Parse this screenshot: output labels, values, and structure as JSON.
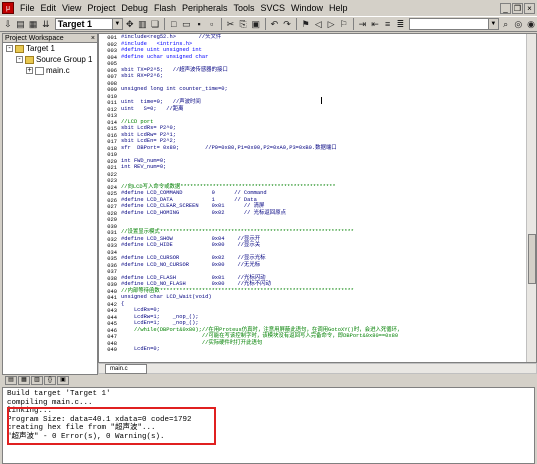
{
  "menu": {
    "items": [
      "File",
      "Edit",
      "View",
      "Project",
      "Debug",
      "Flash",
      "Peripherals",
      "Tools",
      "SVCS",
      "Window",
      "Help"
    ],
    "app_icon": "uvision-icon"
  },
  "toolbar": {
    "target": "Target 1"
  },
  "workspace": {
    "title": "Project Workspace",
    "tree": [
      {
        "label": "Target 1",
        "level": 0,
        "toggle": "-"
      },
      {
        "label": "Source Group 1",
        "level": 1,
        "toggle": "-"
      },
      {
        "label": "main.c",
        "level": 2,
        "toggle": "+"
      }
    ]
  },
  "editor": {
    "tab": "main.c",
    "lines": [
      {
        "n": "001",
        "t": "#include<reg52.h>       //头文件"
      },
      {
        "n": "002",
        "t": "#include   <intrins.h>"
      },
      {
        "n": "003",
        "t": "#define uint unsigned int"
      },
      {
        "n": "004",
        "t": "#define uchar unsigned char"
      },
      {
        "n": "005",
        "t": ""
      },
      {
        "n": "006",
        "t": "sbit TX=P2^5;   //超声波传感器的接口"
      },
      {
        "n": "007",
        "t": "sbit RX=P2^6;"
      },
      {
        "n": "008",
        "t": ""
      },
      {
        "n": "009",
        "t": "unsigned long int counter_time=0;"
      },
      {
        "n": "010",
        "t": ""
      },
      {
        "n": "011",
        "t": "uint  time=0;   //声波时间"
      },
      {
        "n": "012",
        "t": "uint   S=0;   //距离"
      },
      {
        "n": "013",
        "t": ""
      },
      {
        "n": "014",
        "t": "//LCD port"
      },
      {
        "n": "015",
        "t": "sbit LcdRs= P2^0;"
      },
      {
        "n": "016",
        "t": "sbit LcdRw= P2^1;"
      },
      {
        "n": "017",
        "t": "sbit LcdEn= P2^2;"
      },
      {
        "n": "018",
        "t": "sfr  DBPort= 0x80;        //P0=0x80,P1=0x90,P2=0xA0,P3=0xB0.数据端口"
      },
      {
        "n": "019",
        "t": ""
      },
      {
        "n": "020",
        "t": "int FWD_num=0;"
      },
      {
        "n": "021",
        "t": "int REV_num=0;"
      },
      {
        "n": "022",
        "t": ""
      },
      {
        "n": "023",
        "t": ""
      },
      {
        "n": "024",
        "t": "//向LCD写入命令或数据************************************************"
      },
      {
        "n": "025",
        "t": "#define LCD_COMMAND         0      // Command"
      },
      {
        "n": "026",
        "t": "#define LCD_DATA            1      // Data"
      },
      {
        "n": "027",
        "t": "#define LCD_CLEAR_SCREEN    0x01      // 清屏"
      },
      {
        "n": "028",
        "t": "#define LCD_HOMING          0x02      // 光标返回原点"
      },
      {
        "n": "029",
        "t": ""
      },
      {
        "n": "030",
        "t": ""
      },
      {
        "n": "031",
        "t": "//设置显示模式************************************************************"
      },
      {
        "n": "032",
        "t": "#define LCD_SHOW            0x04    //显示开"
      },
      {
        "n": "033",
        "t": "#define LCD_HIDE            0x00    //显示关"
      },
      {
        "n": "034",
        "t": ""
      },
      {
        "n": "035",
        "t": "#define LCD_CURSOR          0x02    //显示光标"
      },
      {
        "n": "036",
        "t": "#define LCD_NO_CURSOR       0x00    //无光标"
      },
      {
        "n": "037",
        "t": ""
      },
      {
        "n": "038",
        "t": "#define LCD_FLASH           0x01    //光标闪动"
      },
      {
        "n": "039",
        "t": "#define LCD_NO_FLASH        0x00    //光标不闪动"
      },
      {
        "n": "040",
        "t": "//内部等待函数************************************************************"
      },
      {
        "n": "041",
        "t": "unsigned char LCD_Wait(void)"
      },
      {
        "n": "042",
        "t": "{"
      },
      {
        "n": "043",
        "t": "    LcdRs=0;"
      },
      {
        "n": "044",
        "t": "    LcdRw=1;    _nop_();"
      },
      {
        "n": "045",
        "t": "    LcdEn=1;    _nop_();"
      },
      {
        "n": "046",
        "t": "    //while(DBPort&0x80);//在用Proteus仿真时，注意用屏蔽此语句，在调用GotoXY()时，会进入死循环，"
      },
      {
        "n": "047",
        "t": "                         //可能在写该控制字时，该模块没有返回写入完备命令，即DBPort&0x80==0x80"
      },
      {
        "n": "048",
        "t": "                         //实际硬件时打开此语句"
      },
      {
        "n": "049",
        "t": "    LcdEn=0;"
      }
    ]
  },
  "output": {
    "lines": [
      "Build target 'Target 1'",
      "compiling main.c...",
      "linking...",
      "Program Size: data=40.1 xdata=0 code=1792",
      "creating hex file from \"超声波\"...",
      "\"超声波\" - 0 Error(s), 0 Warning(s)."
    ]
  },
  "colors": {
    "comment": "#008000",
    "keyword": "#0000ff",
    "highlight_box": "#e02020"
  }
}
